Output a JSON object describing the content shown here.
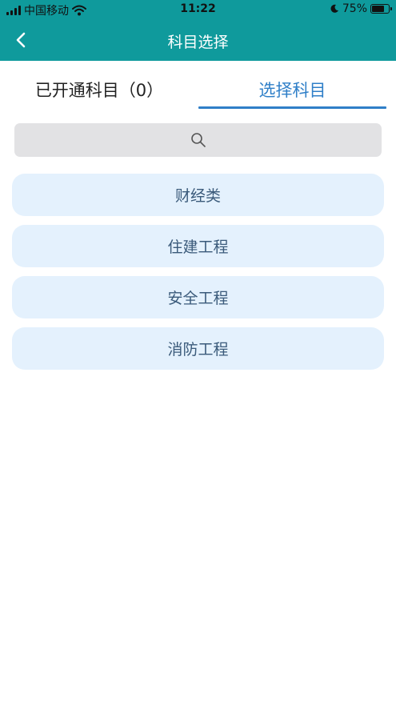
{
  "status_bar": {
    "carrier": "中国移动",
    "time": "11:22",
    "battery_percent": "75%",
    "battery_level": 0.75
  },
  "nav": {
    "title": "科目选择",
    "back_icon": "chevron-left-icon"
  },
  "tabs": [
    {
      "label": "已开通科目（0）",
      "active": false
    },
    {
      "label": "选择科目",
      "active": true
    }
  ],
  "search": {
    "icon": "search-icon"
  },
  "subjects": [
    {
      "label": "财经类"
    },
    {
      "label": "住建工程"
    },
    {
      "label": "安全工程"
    },
    {
      "label": "消防工程"
    }
  ],
  "colors": {
    "header": "#0f9a9c",
    "active_tab": "#2f7fc8",
    "item_bg": "#e4f1fd",
    "item_text": "#3a5a7a",
    "search_bg": "#e2e2e4"
  }
}
